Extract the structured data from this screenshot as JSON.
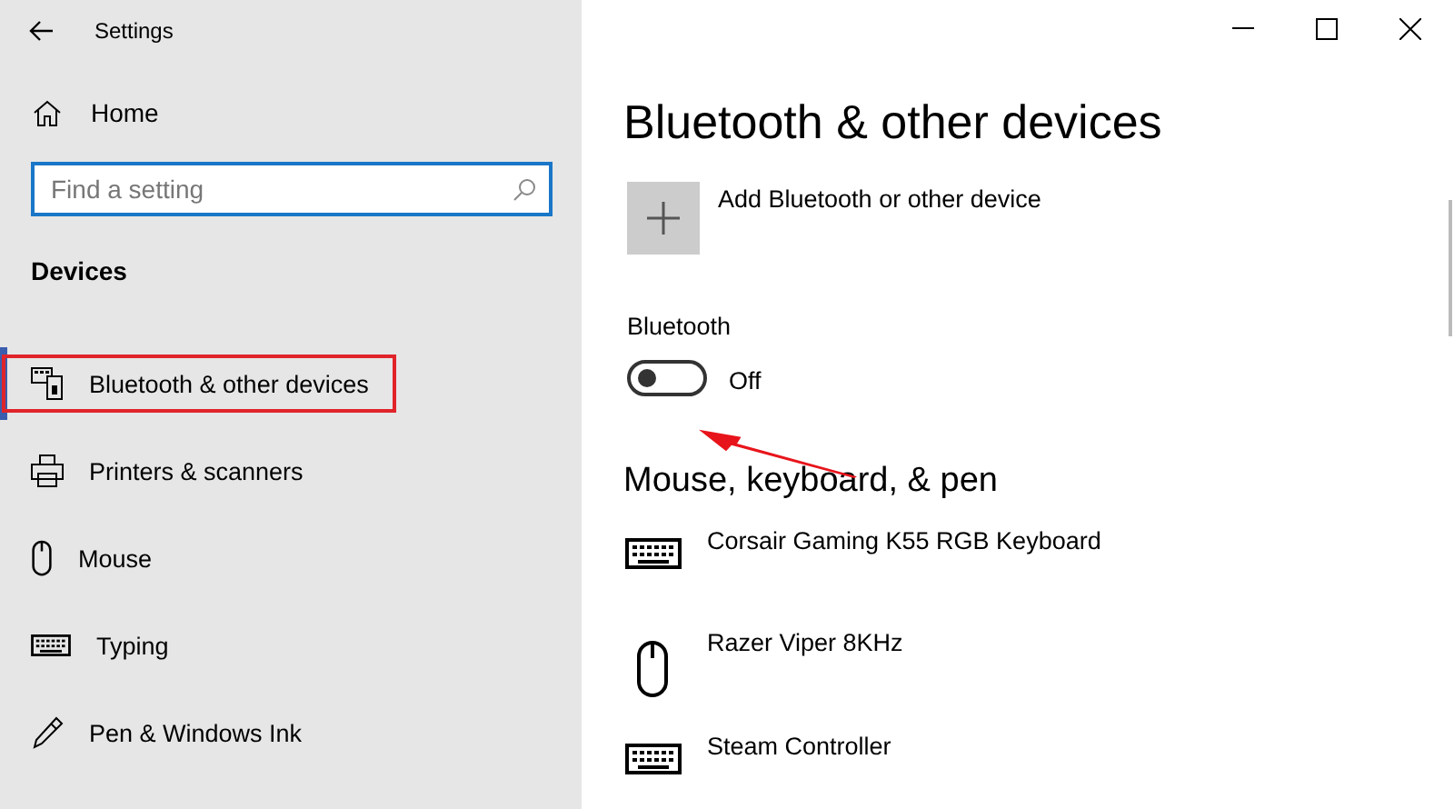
{
  "window": {
    "title": "Settings"
  },
  "sidebar": {
    "home": "Home",
    "search": {
      "placeholder": "Find a setting"
    },
    "section": "Devices",
    "items": [
      {
        "label": "Bluetooth & other devices",
        "kind": "bluetooth",
        "selected": true,
        "highlighted": true
      },
      {
        "label": "Printers & scanners",
        "kind": "printer",
        "selected": false,
        "highlighted": false
      },
      {
        "label": "Mouse",
        "kind": "mouse",
        "selected": false,
        "highlighted": false
      },
      {
        "label": "Typing",
        "kind": "keyboard",
        "selected": false,
        "highlighted": false
      },
      {
        "label": "Pen & Windows Ink",
        "kind": "pen",
        "selected": false,
        "highlighted": false
      }
    ]
  },
  "main": {
    "title": "Bluetooth & other devices",
    "add_device": "Add Bluetooth or other device",
    "bluetooth": {
      "label": "Bluetooth",
      "on": false,
      "state_text": "Off",
      "pointer_arrow": true
    },
    "section": "Mouse, keyboard, & pen",
    "devices": [
      {
        "name": "Corsair Gaming K55 RGB Keyboard",
        "kind": "keyboard"
      },
      {
        "name": "Razer Viper 8KHz",
        "kind": "mouse"
      },
      {
        "name": "Steam Controller",
        "kind": "keyboard"
      }
    ]
  }
}
